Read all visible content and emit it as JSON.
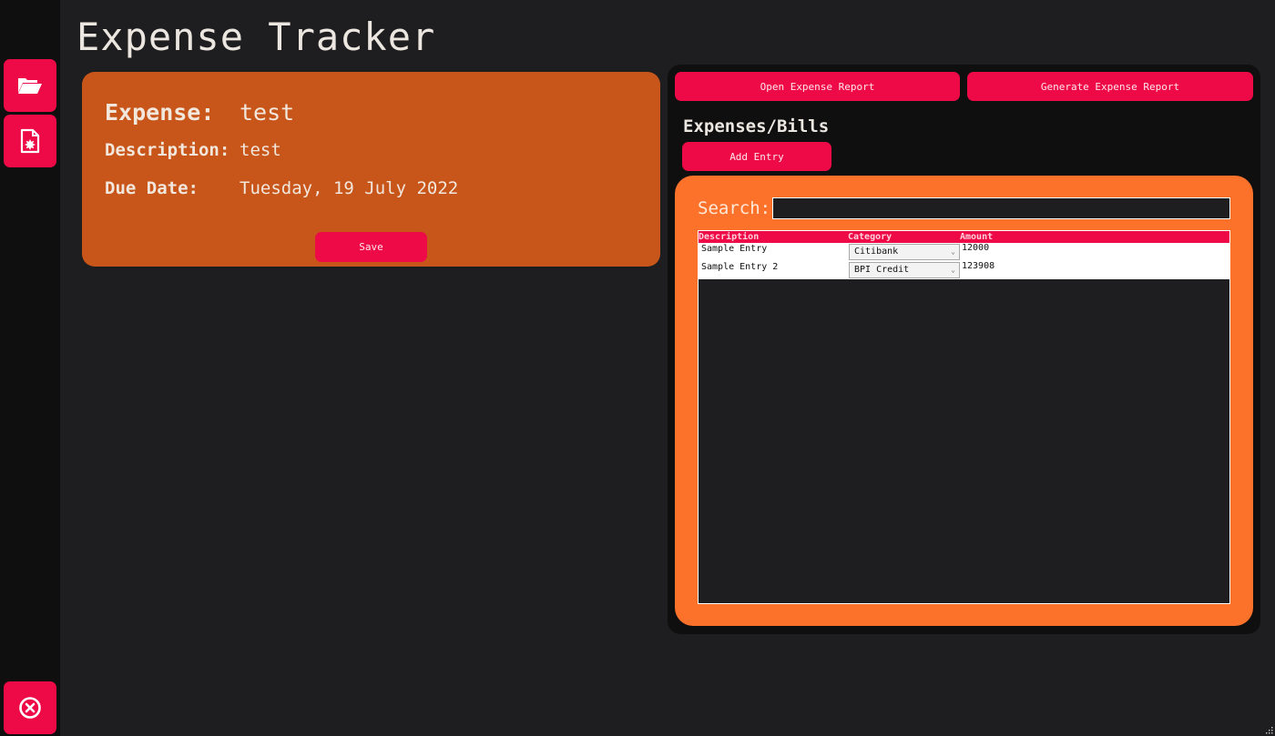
{
  "app": {
    "title": "Expense Tracker"
  },
  "sidebar": {
    "items": [
      {
        "icon": "folder-open-icon"
      },
      {
        "icon": "new-file-icon"
      }
    ],
    "close": {
      "icon": "close-circle-icon"
    }
  },
  "detail": {
    "expense_label": "Expense:",
    "expense_value": "test",
    "description_label": "Description:",
    "description_value": "test",
    "due_label": "Due Date:",
    "due_value": "Tuesday, 19 July 2022",
    "save_label": "Save"
  },
  "panel": {
    "open_report_label": "Open Expense Report",
    "generate_report_label": "Generate Expense Report",
    "section_title": "Expenses/Bills",
    "add_entry_label": "Add Entry",
    "search_label": "Search:",
    "search_value": "",
    "table": {
      "columns": [
        "Description",
        "Category",
        "Amount"
      ],
      "rows": [
        {
          "description": "Sample Entry",
          "category": "Citibank",
          "amount": "12000"
        },
        {
          "description": "Sample Entry 2",
          "category": "BPI Credit",
          "amount": "123908"
        }
      ]
    }
  },
  "colors": {
    "accent": "#ee0a47",
    "card": "#c8561a",
    "orange": "#fc722b",
    "background": "#1e1d1f",
    "sidebar": "#0f0f10"
  }
}
